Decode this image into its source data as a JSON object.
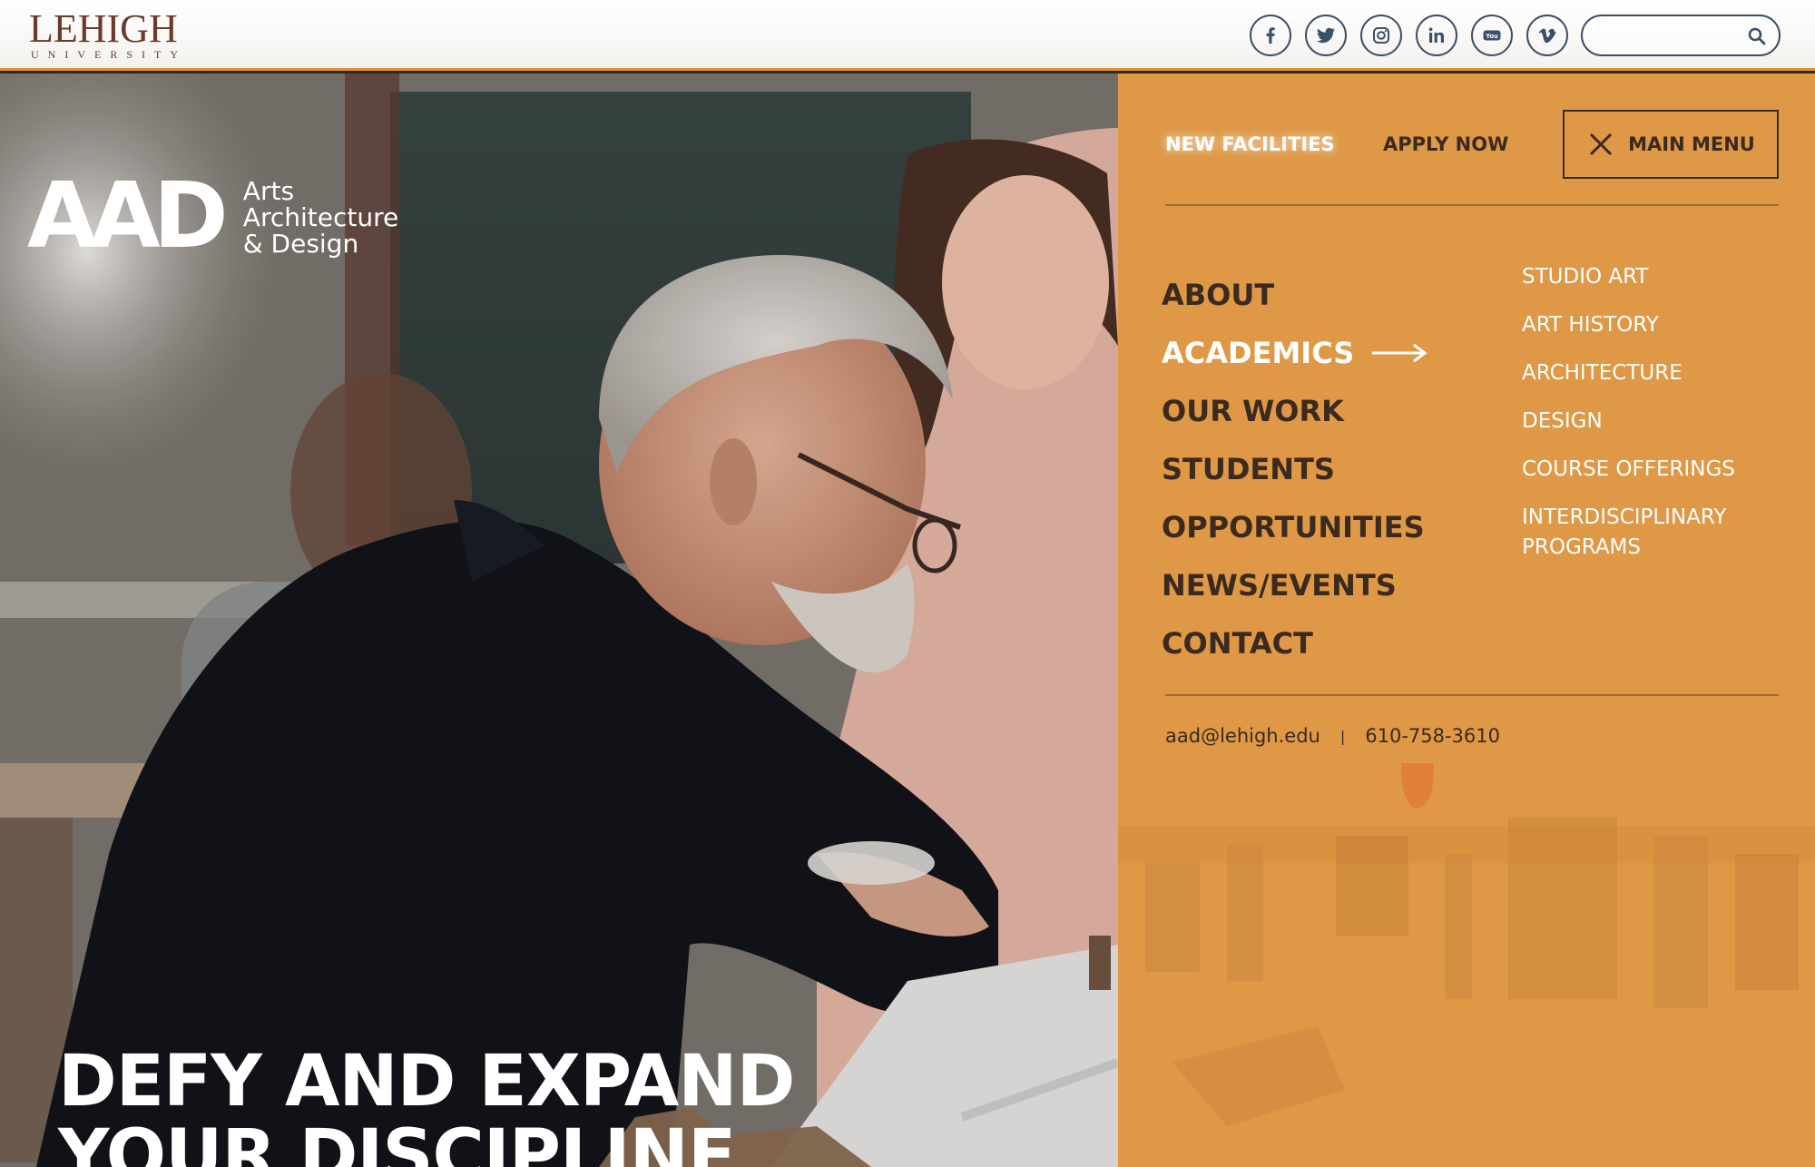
{
  "header": {
    "logo_word": "LEHIGH",
    "logo_sub": "UNIVERSITY",
    "social": [
      {
        "name": "facebook-icon"
      },
      {
        "name": "twitter-icon"
      },
      {
        "name": "instagram-icon"
      },
      {
        "name": "linkedin-icon"
      },
      {
        "name": "youtube-icon"
      },
      {
        "name": "vimeo-icon"
      }
    ],
    "search": {
      "value": "",
      "placeholder": ""
    }
  },
  "brand": {
    "mark": "AAD",
    "line1": "Arts",
    "line2": "Architecture",
    "line3": "& Design"
  },
  "hero": {
    "headline_line1": "DEFY AND EXPAND",
    "headline_line2": "YOUR DISCIPLINE"
  },
  "menu": {
    "top_links": {
      "new_facilities": "NEW FACILITIES",
      "apply_now": "APPLY NOW"
    },
    "main_menu_label": "MAIN MENU",
    "items": [
      "ABOUT",
      "ACADEMICS",
      "OUR WORK",
      "STUDENTS",
      "OPPORTUNITIES",
      "NEWS/EVENTS",
      "CONTACT"
    ],
    "active_item": "ACADEMICS",
    "sub_items": [
      "STUDIO ART",
      "ART HISTORY",
      "ARCHITECTURE",
      "DESIGN",
      "COURSE OFFERINGS",
      "INTERDISCIPLINARY PROGRAMS"
    ],
    "contact": {
      "email": "aad@lehigh.edu",
      "separator": "|",
      "phone": "610-758-3610"
    }
  },
  "colors": {
    "accent": "#e89e48",
    "dark_text": "#3b2a20",
    "icon_navy": "#3c4f68",
    "lehigh_brown": "#6b3a2a"
  }
}
